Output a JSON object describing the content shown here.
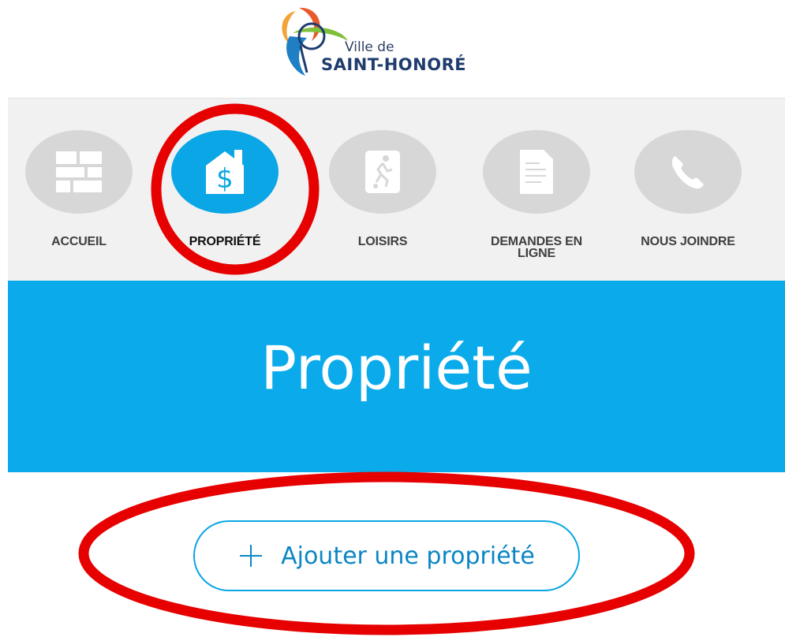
{
  "logo": {
    "small_text": "Ville de",
    "big_text": "SAINT-HONORÉ"
  },
  "nav": {
    "items": [
      {
        "label": "ACCUEIL",
        "icon": "home-grid-icon",
        "active": false
      },
      {
        "label": "PROPRIÉTÉ",
        "icon": "house-dollar-icon",
        "active": true
      },
      {
        "label": "LOISIRS",
        "icon": "soccer-player-icon",
        "active": false
      },
      {
        "label_line1": "DEMANDES EN",
        "label_line2": "LIGNE",
        "icon": "document-icon",
        "active": false
      },
      {
        "label": "NOUS JOINDRE",
        "icon": "phone-icon",
        "active": false
      }
    ]
  },
  "hero": {
    "title": "Propriété"
  },
  "actions": {
    "add_property_label": "Ajouter une propriété"
  },
  "colors": {
    "accent": "#0aa6e5",
    "hero_bg": "#0aaaeb",
    "nav_bg": "#f1f1f1",
    "inactive_icon_bg": "#d7d7d7",
    "annotation": "#e60000"
  }
}
